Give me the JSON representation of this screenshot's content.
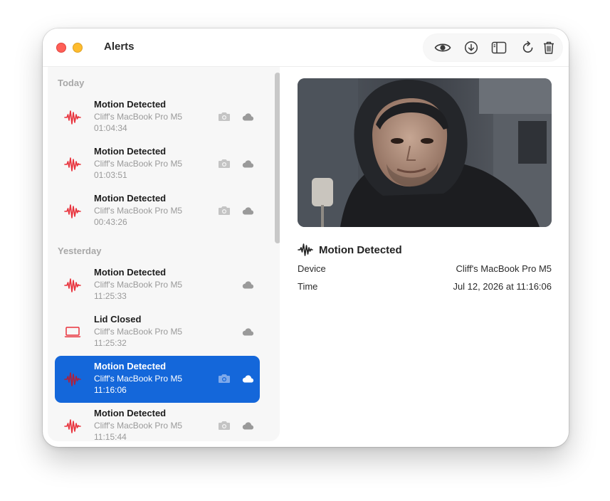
{
  "window": {
    "title": "Alerts",
    "traffic_lights": {
      "close_color": "#ff5f57",
      "minimize_color": "#febc2e"
    }
  },
  "toolbar": {
    "buttons": [
      {
        "name": "eye-icon"
      },
      {
        "name": "download-icon"
      },
      {
        "name": "sidebar-toggle-icon"
      },
      {
        "name": "refresh-icon"
      },
      {
        "name": "trash-icon"
      }
    ]
  },
  "sidebar": {
    "sections": [
      {
        "header": "Today",
        "items": [
          {
            "title": "Motion Detected",
            "device": "Cliff's MacBook Pro M5",
            "time": "01:04:34",
            "icon": "motion-waveform-icon",
            "has_camera": true,
            "has_cloud": true
          },
          {
            "title": "Motion Detected",
            "device": "Cliff's MacBook Pro M5",
            "time": "01:03:51",
            "icon": "motion-waveform-icon",
            "has_camera": true,
            "has_cloud": true
          },
          {
            "title": "Motion Detected",
            "device": "Cliff's MacBook Pro M5",
            "time": "00:43:26",
            "icon": "motion-waveform-icon",
            "has_camera": true,
            "has_cloud": true
          }
        ]
      },
      {
        "header": "Yesterday",
        "items": [
          {
            "title": "Motion Detected",
            "device": "Cliff's MacBook Pro M5",
            "time": "11:25:33",
            "icon": "motion-waveform-icon",
            "has_camera": false,
            "has_cloud": true
          },
          {
            "title": "Lid Closed",
            "device": "Cliff's MacBook Pro M5",
            "time": "11:25:32",
            "icon": "laptop-icon",
            "has_camera": false,
            "has_cloud": true
          },
          {
            "title": "Motion Detected",
            "device": "Cliff's MacBook Pro M5",
            "time": "11:16:06",
            "icon": "motion-waveform-icon",
            "has_camera": true,
            "has_cloud": true,
            "selected": true
          },
          {
            "title": "Motion Detected",
            "device": "Cliff's MacBook Pro M5",
            "time": "11:15:44",
            "icon": "motion-waveform-icon",
            "has_camera": true,
            "has_cloud": true
          }
        ]
      }
    ]
  },
  "detail": {
    "title": "Motion Detected",
    "device_label": "Device",
    "device_value": "Cliff's MacBook Pro M5",
    "time_label": "Time",
    "time_value": "Jul 12, 2026 at 11:16:06"
  },
  "colors": {
    "accent": "#1467da",
    "alert_red": "#e8323c",
    "icon_gray": "#9a9a9a"
  }
}
